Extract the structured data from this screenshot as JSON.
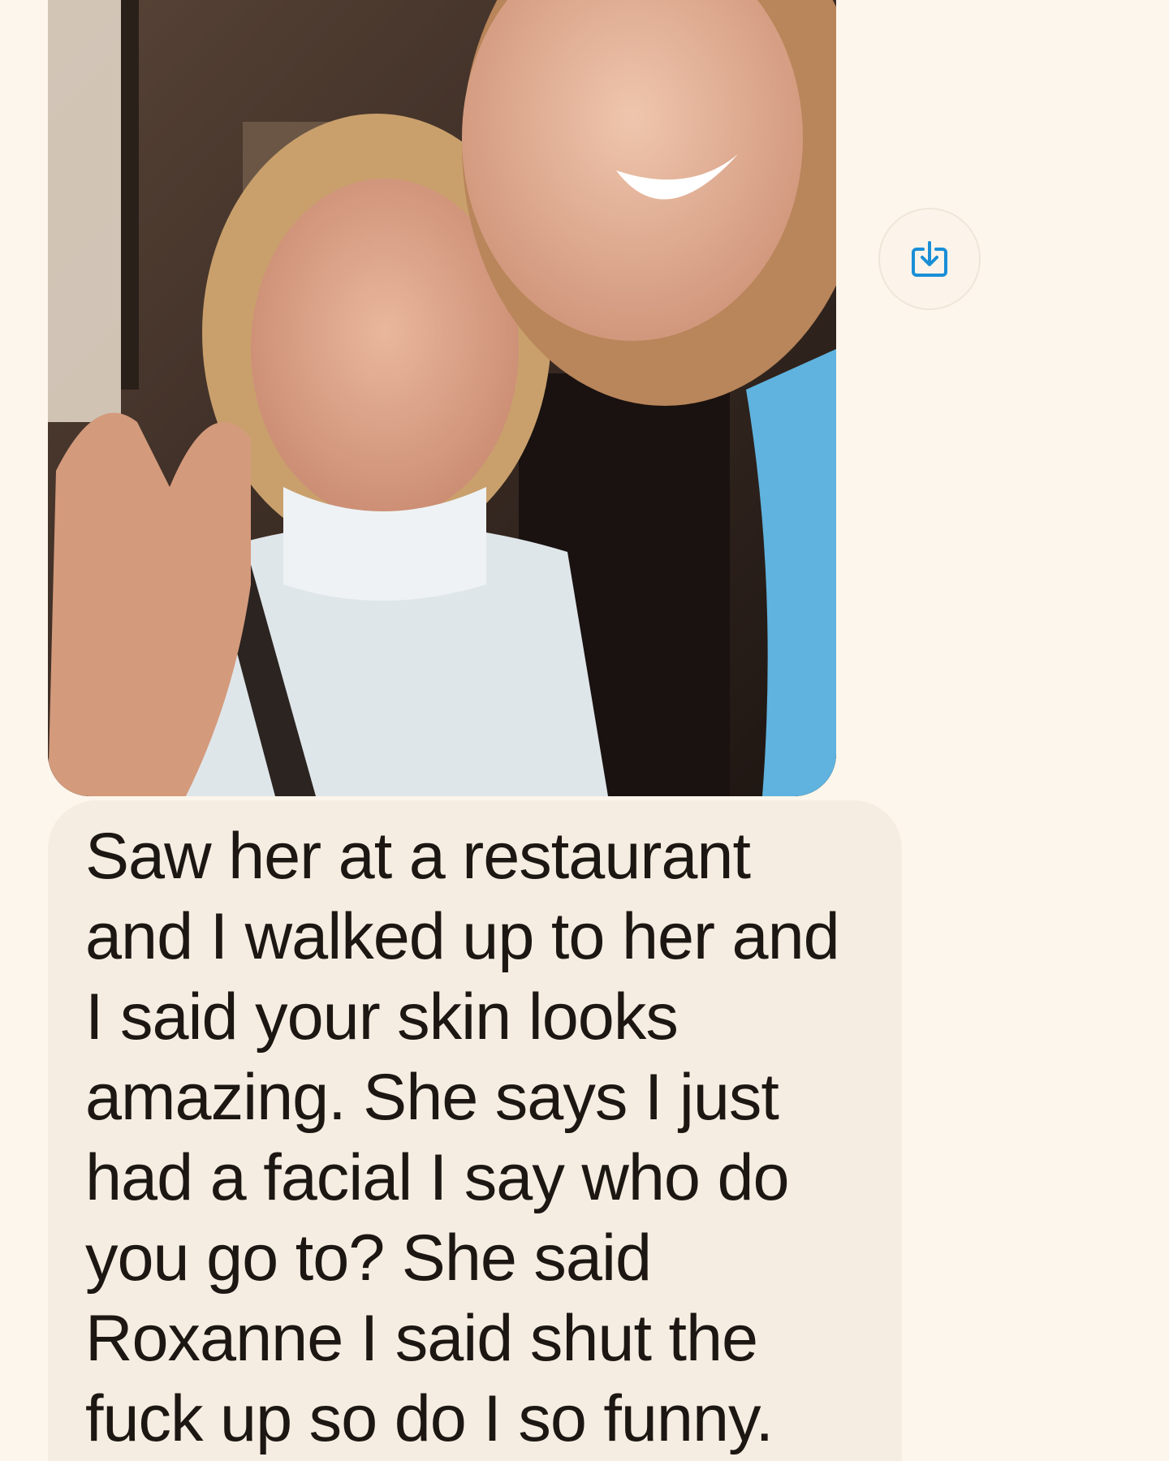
{
  "conversation": {
    "attachment": {
      "type": "photo",
      "icon": "photo-thumbnail"
    },
    "save_button": {
      "icon": "save-download-icon",
      "accent_color": "#1a8fd6"
    },
    "message": {
      "text": "Saw her at a restaurant and I walked up to her and I said your skin looks amazing. She says I just had a facial I say who do you go to? She said Roxanne I said shut the fuck up so do I so funny."
    }
  }
}
